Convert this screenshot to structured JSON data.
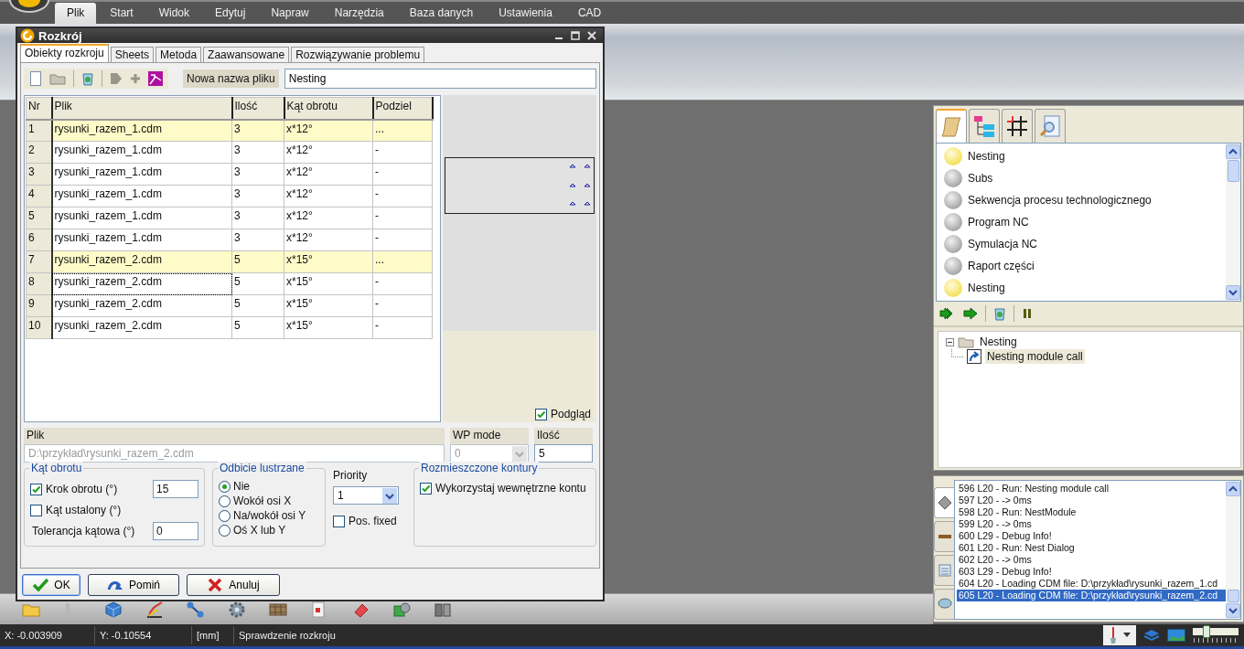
{
  "menu": [
    {
      "label": "Plik",
      "selected": true
    },
    {
      "label": "Start",
      "selected": false
    },
    {
      "label": "Widok",
      "selected": false
    },
    {
      "label": "Edytuj",
      "selected": false
    },
    {
      "label": "Napraw",
      "selected": false
    },
    {
      "label": "Narzędzia",
      "selected": false
    },
    {
      "label": "Baza danych",
      "selected": false
    },
    {
      "label": "Ustawienia",
      "selected": false
    },
    {
      "label": "CAD",
      "selected": false
    }
  ],
  "dialog": {
    "title": "Rozkrój",
    "tabs": [
      {
        "label": "Obiekty rozkroju",
        "selected": true
      },
      {
        "label": "Sheets",
        "selected": false
      },
      {
        "label": "Metoda",
        "selected": false
      },
      {
        "label": "Zaawansowane",
        "selected": false
      },
      {
        "label": "Rozwiązywanie problemu",
        "selected": false
      }
    ],
    "file_name": {
      "label": "Nowa nazwa pliku",
      "value": "Nesting"
    },
    "table": {
      "columns": [
        "Nr",
        "Plik",
        "Ilość",
        "Kąt obrotu",
        "Podziel"
      ],
      "rows": [
        {
          "cells": [
            "1",
            "rysunki_razem_1.cdm",
            "3",
            "x*12°",
            "..."
          ],
          "highlighted": true,
          "focused": false
        },
        {
          "cells": [
            "2",
            "rysunki_razem_1.cdm",
            "3",
            "x*12°",
            "-"
          ],
          "highlighted": false,
          "focused": false
        },
        {
          "cells": [
            "3",
            "rysunki_razem_1.cdm",
            "3",
            "x*12°",
            "-"
          ],
          "highlighted": false,
          "focused": false
        },
        {
          "cells": [
            "4",
            "rysunki_razem_1.cdm",
            "3",
            "x*12°",
            "-"
          ],
          "highlighted": false,
          "focused": false
        },
        {
          "cells": [
            "5",
            "rysunki_razem_1.cdm",
            "3",
            "x*12°",
            "-"
          ],
          "highlighted": false,
          "focused": false
        },
        {
          "cells": [
            "6",
            "rysunki_razem_1.cdm",
            "3",
            "x*12°",
            "-"
          ],
          "highlighted": false,
          "focused": false
        },
        {
          "cells": [
            "7",
            "rysunki_razem_2.cdm",
            "5",
            "x*15°",
            "..."
          ],
          "highlighted": true,
          "focused": false
        },
        {
          "cells": [
            "8",
            "rysunki_razem_2.cdm",
            "5",
            "x*15°",
            "-"
          ],
          "highlighted": false,
          "focused": true
        },
        {
          "cells": [
            "9",
            "rysunki_razem_2.cdm",
            "5",
            "x*15°",
            "-"
          ],
          "highlighted": false,
          "focused": false
        },
        {
          "cells": [
            "10",
            "rysunki_razem_2.cdm",
            "5",
            "x*15°",
            "-"
          ],
          "highlighted": false,
          "focused": false
        }
      ]
    },
    "preview": {
      "label": "Podgląd",
      "checked": true
    },
    "details": {
      "file_label": "Plik",
      "file_value": "D:\\przykład\\rysunki_razem_2.cdm",
      "wp_mode_label": "WP mode",
      "wp_mode_value": "0",
      "quantity_label": "Ilość",
      "quantity_value": "5"
    },
    "rotation": {
      "title": "Kąt obrotu",
      "step_label": "Krok obrotu (°)",
      "step_checked": true,
      "step_value": "15",
      "fixed_label": "Kąt ustalony (°)",
      "fixed_checked": false,
      "tolerance_label": "Tolerancja kątowa (°)",
      "tolerance_value": "0"
    },
    "mirror": {
      "title": "Odbicie lustrzane",
      "options": [
        {
          "label": "Nie",
          "selected": true
        },
        {
          "label": "Wokół osi X",
          "selected": false
        },
        {
          "label": "Na/wokół osi Y",
          "selected": false
        },
        {
          "label": "Oś X lub Y",
          "selected": false
        }
      ]
    },
    "priority": {
      "label": "Priority",
      "value": "1",
      "pos_fixed_label": "Pos. fixed",
      "pos_fixed_checked": false
    },
    "contours": {
      "title": "Rozmieszczone kontury",
      "option_label": "Wykorzystaj wewnętrzne kontu",
      "option_checked": true
    },
    "buttons": [
      {
        "label": "OK",
        "kind": "ok"
      },
      {
        "label": "Pomiń",
        "kind": "skip"
      },
      {
        "label": "Anuluj",
        "kind": "cancel"
      }
    ]
  },
  "right_panel": {
    "tabs": [
      {
        "kind": "scroll",
        "selected": true
      },
      {
        "kind": "hierarchy",
        "selected": false
      },
      {
        "kind": "grid",
        "selected": false
      },
      {
        "kind": "inspect",
        "selected": false
      }
    ],
    "log_tabs": [
      {
        "kind": "diamond",
        "selected": true
      },
      {
        "kind": "ruler",
        "selected": false
      },
      {
        "kind": "calculator",
        "selected": false
      },
      {
        "kind": "speech",
        "selected": false
      }
    ],
    "steps": [
      {
        "label": "Nesting",
        "active": true
      },
      {
        "label": "Subs",
        "active": false
      },
      {
        "label": "Sekwencja procesu technologicznego",
        "active": false
      },
      {
        "label": "Program NC",
        "active": false
      },
      {
        "label": "Symulacja NC",
        "active": false
      },
      {
        "label": "Raport części",
        "active": false
      },
      {
        "label": "Nesting",
        "active": true
      }
    ],
    "tree": [
      {
        "label": "Nesting",
        "expanded": true,
        "children": [
          {
            "label": "Nesting module call",
            "selected": true
          }
        ]
      }
    ],
    "log": [
      {
        "text": "596 L20 - Run: Nesting module call",
        "selected": false
      },
      {
        "text": "597 L20 -  -> 0ms",
        "selected": false
      },
      {
        "text": "598 L20 - Run: NestModule",
        "selected": false
      },
      {
        "text": "599 L20 -  -> 0ms",
        "selected": false
      },
      {
        "text": "600 L29 - Debug Info!",
        "selected": false
      },
      {
        "text": "601 L20 - Run: Nest Dialog",
        "selected": false
      },
      {
        "text": "602 L20 -  -> 0ms",
        "selected": false
      },
      {
        "text": "603 L29 - Debug Info!",
        "selected": false
      },
      {
        "text": "604 L20 - Loading CDM file: D:\\przykład\\rysunki_razem_1.cd",
        "selected": false
      },
      {
        "text": "605 L20 - Loading CDM file: D:\\przykład\\rysunki_razem_2.cd",
        "selected": true
      }
    ]
  },
  "status_bar": {
    "x": "X: -0.003909",
    "y": "Y: -0.10554",
    "unit": "[mm]",
    "message": "Sprawdzenie rozkroju",
    "zoom": {
      "level": 0.3
    }
  }
}
